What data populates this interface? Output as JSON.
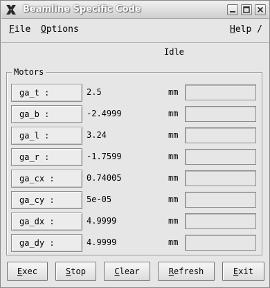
{
  "window": {
    "title": "Beamline Specific Code"
  },
  "menubar": {
    "file": {
      "mnemonic": "F",
      "rest": "ile"
    },
    "options": {
      "mnemonic": "O",
      "rest": "ptions"
    },
    "help": {
      "mnemonic": "H",
      "rest": "elp /"
    }
  },
  "status": "Idle",
  "motors": {
    "title": "Motors",
    "unit": "mm",
    "rows": [
      {
        "label": "ga_t :",
        "value": "2.5",
        "input": ""
      },
      {
        "label": "ga_b :",
        "value": "-2.4999",
        "input": ""
      },
      {
        "label": "ga_l :",
        "value": "3.24",
        "input": ""
      },
      {
        "label": "ga_r :",
        "value": "-1.7599",
        "input": ""
      },
      {
        "label": "ga_cx :",
        "value": "0.74005",
        "input": ""
      },
      {
        "label": "ga_cy :",
        "value": "5e-05",
        "input": ""
      },
      {
        "label": "ga_dx :",
        "value": "4.9999",
        "input": ""
      },
      {
        "label": "ga_dy :",
        "value": "4.9999",
        "input": ""
      }
    ]
  },
  "buttons": {
    "exec": {
      "mnemonic": "E",
      "rest": "xec"
    },
    "stop": {
      "mnemonic": "S",
      "rest": "top"
    },
    "clear": {
      "mnemonic": "C",
      "rest": "lear"
    },
    "refresh": {
      "mnemonic": "R",
      "rest": "efresh"
    },
    "exit": {
      "mnemonic": "E",
      "rest": "xit"
    }
  },
  "colors": {
    "background": "#e6e6e6",
    "title_text": "#ffffff"
  },
  "icons": [
    "x-app-icon",
    "minimize-icon",
    "maximize-icon",
    "close-icon"
  ]
}
